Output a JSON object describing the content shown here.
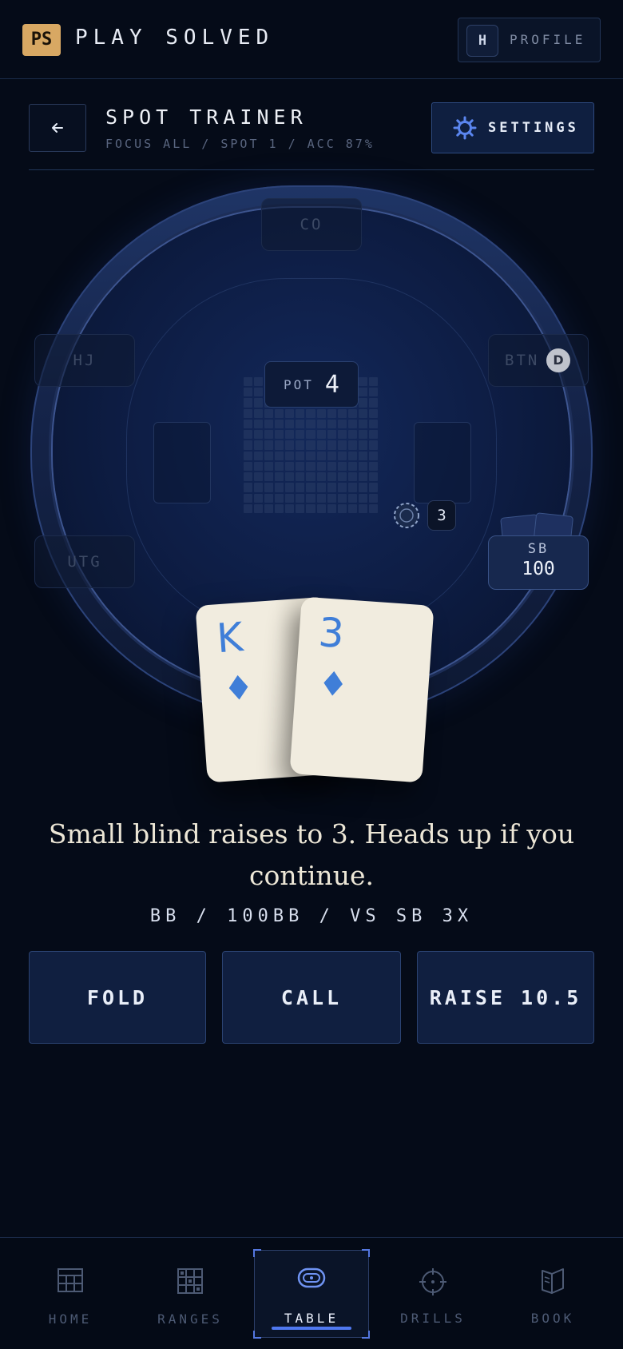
{
  "header": {
    "logo_text": "PS",
    "brand": "PLAY SOLVED",
    "profile_initial": "H",
    "profile_label": "PROFILE"
  },
  "trainer": {
    "title": "SPOT TRAINER",
    "subtitle": "FOCUS ALL / SPOT 1 / ACC 87%",
    "settings_label": "SETTINGS"
  },
  "table": {
    "seats": {
      "co": "CO",
      "hj": "HJ",
      "btn": "BTN",
      "utg": "UTG",
      "sb": "SB"
    },
    "dealer_button": "D",
    "pot_label": "POT",
    "pot_value": "4",
    "sb_bet": "3",
    "sb_stack": "100"
  },
  "hero_hand": [
    {
      "rank": "K",
      "suit": "♦"
    },
    {
      "rank": "3",
      "suit": "♦"
    }
  ],
  "prompt": {
    "text": "Small blind raises to 3. Heads up if you continue.",
    "context": "BB / 100BB / VS SB 3X"
  },
  "actions": {
    "fold": "FOLD",
    "call": "CALL",
    "raise": "RAISE 10.5"
  },
  "nav": {
    "home": "HOME",
    "ranges": "RANGES",
    "table": "TABLE",
    "drills": "DRILLS",
    "book": "BOOK",
    "active": "table"
  },
  "colors": {
    "accent": "#4f78f0",
    "logo": "#d8a863",
    "card_suit": "#3f7ed8",
    "background": "#050b18"
  }
}
